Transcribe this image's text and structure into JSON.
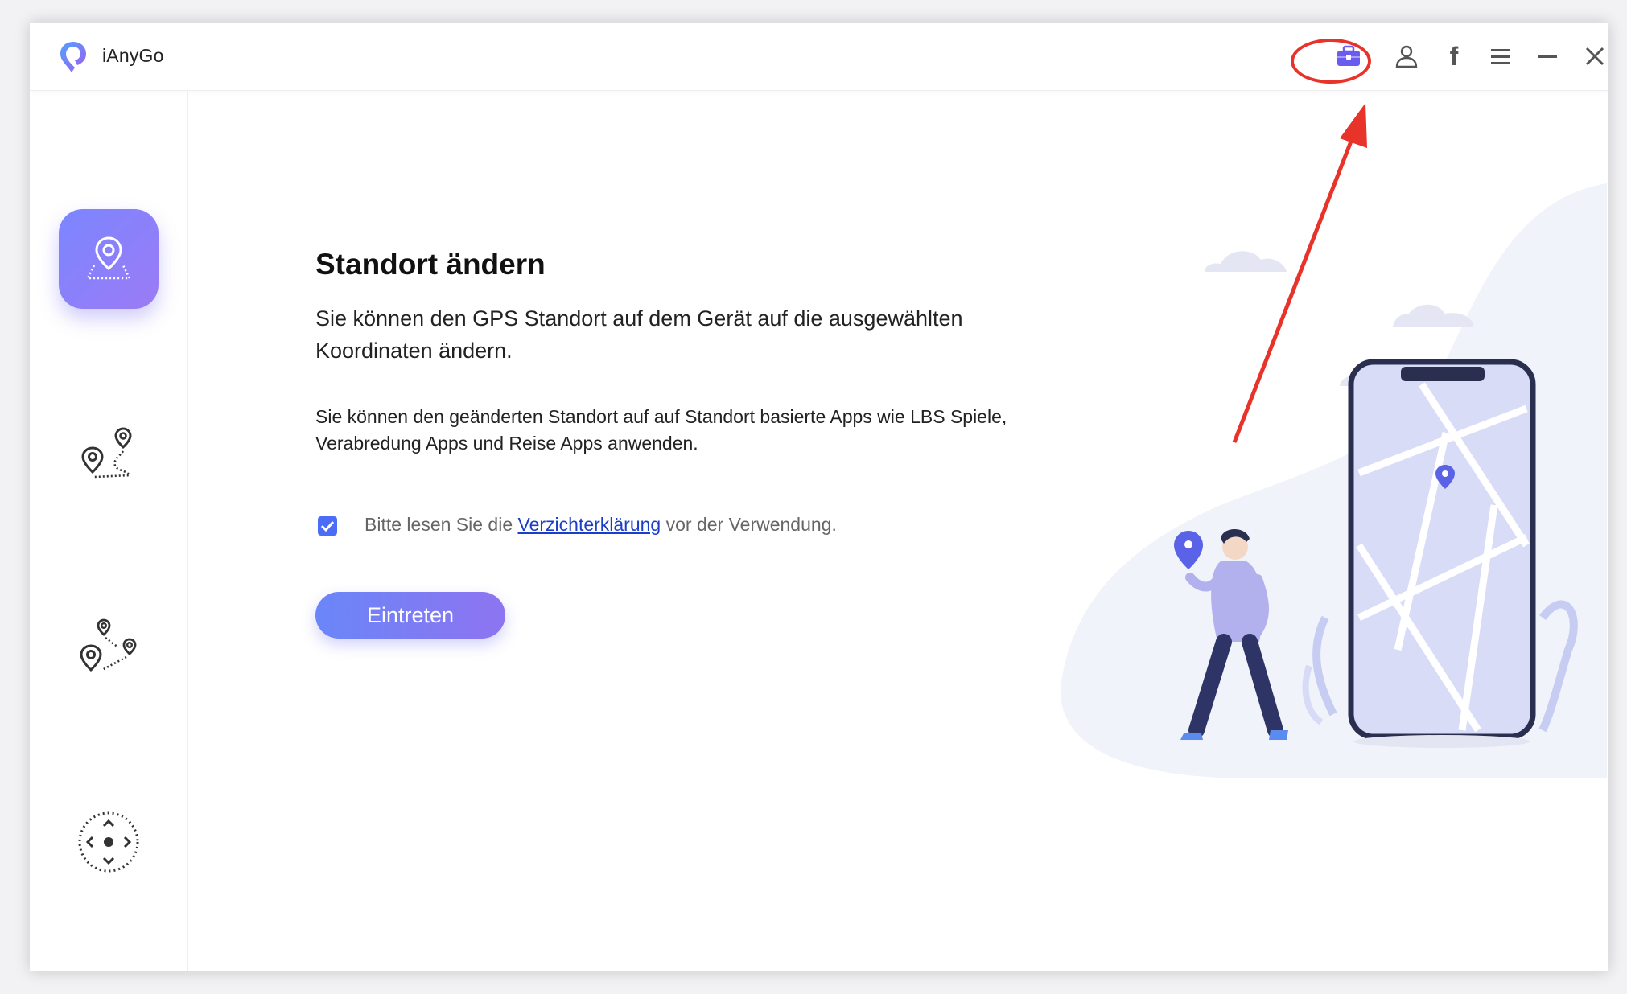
{
  "app": {
    "title": "iAnyGo"
  },
  "toolbar": {
    "icons": [
      "toolbox-icon",
      "user-icon",
      "facebook-icon",
      "menu-icon",
      "minimize-icon",
      "close-icon"
    ],
    "facebook_glyph": "f"
  },
  "sidebar": {
    "items": [
      {
        "id": "change-location",
        "icon": "location-pin-icon",
        "active": true
      },
      {
        "id": "two-spot-movement",
        "icon": "two-spot-route-icon",
        "active": false
      },
      {
        "id": "multi-spot-movement",
        "icon": "multi-spot-route-icon",
        "active": false
      },
      {
        "id": "joystick-movement",
        "icon": "joystick-icon",
        "active": false
      }
    ]
  },
  "main": {
    "heading": "Standort ändern",
    "description": "Sie können den GPS Standort auf dem Gerät auf die ausgewählten Koordinaten ändern.",
    "subdescription": "Sie können den geänderten Standort auf auf Standort basierte Apps wie LBS Spiele, Verabredung Apps und Reise Apps anwenden.",
    "consent_before": "Bitte lesen Sie die ",
    "consent_link": "Verzichterklärung",
    "consent_after": " vor der Verwendung.",
    "consent_checked": true,
    "enter_label": "Eintreten"
  },
  "colors": {
    "accent": "#6f7ff7",
    "annotation": "#e8332a",
    "link": "#1a3ec8"
  }
}
